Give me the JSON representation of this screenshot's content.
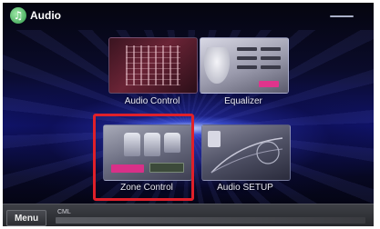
{
  "header": {
    "app_icon_glyph": "♫",
    "title": "Audio"
  },
  "tiles": [
    {
      "label": "Audio Control",
      "icon": "audio-control-icon"
    },
    {
      "label": "Equalizer",
      "icon": "equalizer-icon"
    },
    {
      "label": "Zone Control",
      "icon": "zone-control-icon",
      "highlighted": true
    },
    {
      "label": "Audio SETUP",
      "icon": "audio-setup-icon"
    }
  ],
  "footer": {
    "menu_label": "Menu",
    "info_text": "CML"
  },
  "colors": {
    "highlight": "#e0202a",
    "accent_pink": "#e0348c",
    "background": "#0a0b2a"
  }
}
